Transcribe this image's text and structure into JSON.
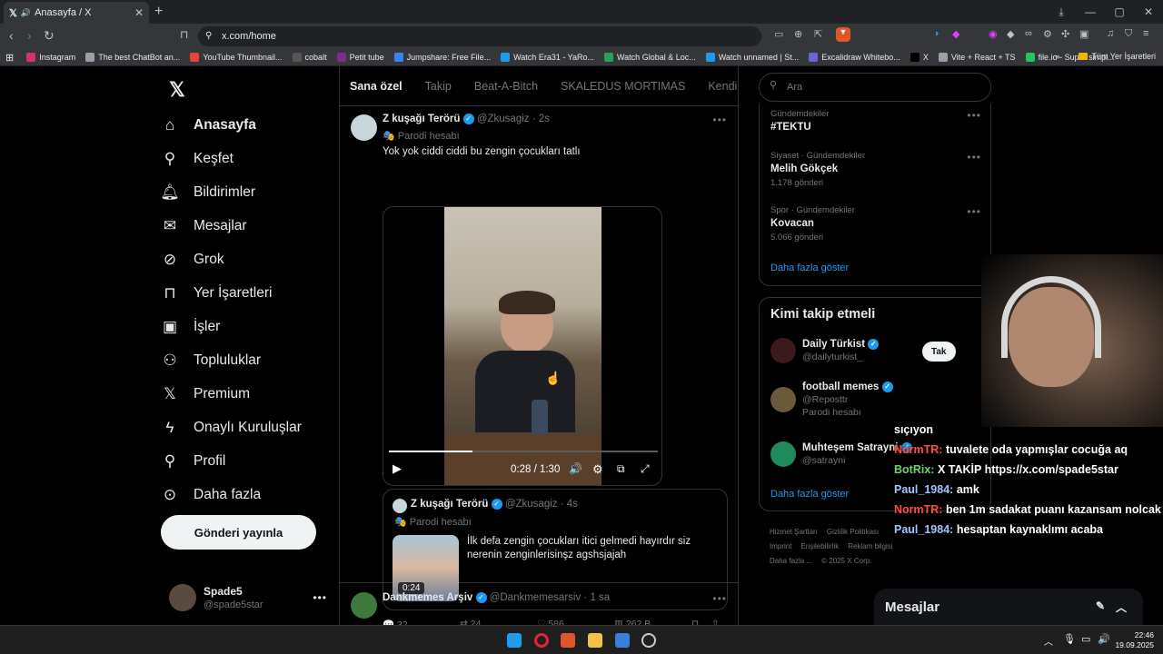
{
  "browser": {
    "tab_title": "Anasayfa / X",
    "url": "x.com/home",
    "bookmarks": [
      {
        "label": "Instagram",
        "color": "#d6336c"
      },
      {
        "label": "The best ChatBot an...",
        "color": "#9aa0a6"
      },
      {
        "label": "YouTube Thumbnail...",
        "color": "#ea4335"
      },
      {
        "label": "cobalt",
        "color": "#555555"
      },
      {
        "label": "Petit tube",
        "color": "#7b2d8e"
      },
      {
        "label": "Jumpshare: Free File...",
        "color": "#3b82f6"
      },
      {
        "label": "Watch Era31 - YaRo...",
        "color": "#1d9bf0"
      },
      {
        "label": "Watch Global & Loc...",
        "color": "#22a559"
      },
      {
        "label": "Watch unnamed | St...",
        "color": "#1d9bf0"
      },
      {
        "label": "Excalidraw Whitebo...",
        "color": "#6965db"
      },
      {
        "label": "X",
        "color": "#000000"
      },
      {
        "label": "Vite + React + TS",
        "color": "#9aa0a6"
      },
      {
        "label": "file.io - Super simpl...",
        "color": "#22c55e"
      }
    ],
    "all_bookmarks": "Tüm Yer İşaretleri"
  },
  "nav": {
    "items": [
      {
        "label": "Anasayfa",
        "icon": "home-icon"
      },
      {
        "label": "Keşfet",
        "icon": "search-icon"
      },
      {
        "label": "Bildirimler",
        "icon": "bell-icon"
      },
      {
        "label": "Mesajlar",
        "icon": "mail-icon"
      },
      {
        "label": "Grok",
        "icon": "grok-icon"
      },
      {
        "label": "Yer İşaretleri",
        "icon": "bookmark-icon"
      },
      {
        "label": "İşler",
        "icon": "briefcase-icon"
      },
      {
        "label": "Topluluklar",
        "icon": "people-icon"
      },
      {
        "label": "Premium",
        "icon": "x-logo-icon"
      },
      {
        "label": "Onaylı Kuruluşlar",
        "icon": "lightning-icon"
      },
      {
        "label": "Profil",
        "icon": "person-icon"
      },
      {
        "label": "Daha fazla",
        "icon": "more-circle-icon"
      }
    ],
    "post_button": "Gönderi yayınla",
    "profile": {
      "name": "Spade5",
      "handle": "@spade5star"
    }
  },
  "feed": {
    "tabs": [
      "Sana özel",
      "Takip",
      "Beat-A-Bitch",
      "SKALEDUS MORTIMAS",
      "Kendine Müz"
    ],
    "tweet": {
      "author": "Z kuşağı Terörü",
      "handle": "@Zkusagiz",
      "time": "2s",
      "parody": "Parodi hesabı",
      "text": "Yok yok ciddi ciddi bu zengin çocukları tatlı",
      "video_time": "0:28 / 1:30",
      "video_progress": 0.31,
      "quote": {
        "author": "Z kuşağı Terörü",
        "handle": "@Zkusagiz",
        "time": "4s",
        "parody": "Parodi hesabı",
        "text": "İlk defa zengin çocukları itici gelmedi hayırdır siz nerenin zenginlerisinşz agshsjajah",
        "thumb_duration": "0:24"
      },
      "stats": {
        "replies": "32",
        "reposts": "24",
        "likes": "586",
        "views": "262 B"
      }
    },
    "next_tweet": {
      "author": "Dankmemes Arşiv",
      "handle": "@Dankmemesarsiv",
      "time": "1 sa"
    }
  },
  "right": {
    "search_placeholder": "Ara",
    "trends": [
      {
        "meta": "Gündemdekiler",
        "title": "#TEKTU",
        "count": ""
      },
      {
        "meta": "Siyaset · Gündemdekiler",
        "title": "Melih Gökçek",
        "count": "1.178 gönderi"
      },
      {
        "meta": "Spor · Gündemdekiler",
        "title": "Kovacan",
        "count": "5.066 gönderi"
      }
    ],
    "show_more": "Daha fazla göster",
    "who_title": "Kimi takip etmeli",
    "who": [
      {
        "name": "Daily Türkist",
        "handle": "@dailyturkist_",
        "note": ""
      },
      {
        "name": "football memes",
        "handle": "@Reposttr",
        "note": "Parodi hesabı"
      },
      {
        "name": "Muhteşem Satrayni",
        "handle": "@satrayni",
        "note": ""
      }
    ],
    "follow_partial": "Tak",
    "follow_partial2": "Takip et",
    "show_more_2": "Daha fazla göster",
    "footer": [
      "Hizmet Şartları",
      "Gizlilik Politikası",
      "Imprint",
      "Erişilebilirlik",
      "Reklam bilgisi",
      "Daha fazla ...",
      "© 2025 X Corp."
    ]
  },
  "stream_chat": [
    {
      "user": "",
      "text": "sıçıyon",
      "color": ""
    },
    {
      "user": "NormTR:",
      "text": "tuvalete oda yapmışlar cocuğa aq",
      "color": "red"
    },
    {
      "user": "BotRix:",
      "text": "X TAKİP https://x.com/spade5star",
      "color": "green"
    },
    {
      "user": "Paul_1984:",
      "text": "amk",
      "color": "blue"
    },
    {
      "user": "NormTR:",
      "text": "ben 1m sadakat puanı kazansam nolcak",
      "color": "red"
    },
    {
      "user": "Paul_1984:",
      "text": "hesaptan kaynaklımı acaba",
      "color": "blue"
    }
  ],
  "dm_bar": "Mesajlar",
  "taskbar": {
    "time": "22:46",
    "date": "19.09.2025"
  }
}
